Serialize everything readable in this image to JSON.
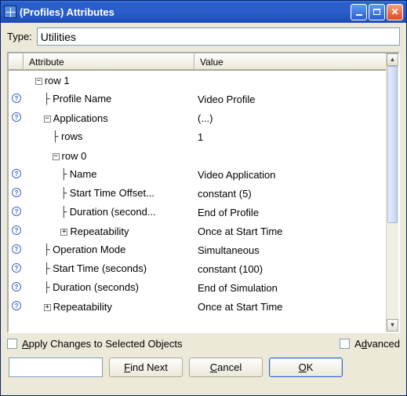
{
  "window": {
    "title": "(Profiles) Attributes"
  },
  "type": {
    "label": "Type:",
    "value": "Utilities"
  },
  "grid": {
    "headers": {
      "attribute": "Attribute",
      "value": "Value"
    },
    "rows": [
      {
        "indent": 1,
        "box": "-",
        "help": "",
        "attr": "row 1",
        "val": ""
      },
      {
        "indent": 2,
        "box": "",
        "help": "?",
        "attr": "Profile Name",
        "val": "Video Profile"
      },
      {
        "indent": 2,
        "box": "-",
        "help": "?",
        "attr": "Applications",
        "val": "(...)"
      },
      {
        "indent": 3,
        "box": "",
        "help": "",
        "attr": "rows",
        "val": "1"
      },
      {
        "indent": 3,
        "box": "-",
        "help": "",
        "attr": "row 0",
        "val": ""
      },
      {
        "indent": 4,
        "box": "",
        "help": "?",
        "attr": "Name",
        "val": "Video Application"
      },
      {
        "indent": 4,
        "box": "",
        "help": "?",
        "attr": "Start Time Offset...",
        "val": "constant (5)"
      },
      {
        "indent": 4,
        "box": "",
        "help": "?",
        "attr": "Duration (second...",
        "val": "End of Profile"
      },
      {
        "indent": 4,
        "box": "+",
        "help": "?",
        "attr": "Repeatability",
        "val": "Once at Start Time"
      },
      {
        "indent": 2,
        "box": "",
        "help": "?",
        "attr": "Operation Mode",
        "val": "Simultaneous"
      },
      {
        "indent": 2,
        "box": "",
        "help": "?",
        "attr": "Start Time (seconds)",
        "val": "constant (100)"
      },
      {
        "indent": 2,
        "box": "",
        "help": "?",
        "attr": "Duration (seconds)",
        "val": "End of Simulation"
      },
      {
        "indent": 2,
        "box": "+",
        "help": "?",
        "attr": "Repeatability",
        "val": "Once at Start Time"
      }
    ]
  },
  "checkboxes": {
    "apply": "Apply Changes to Selected Objects",
    "advanced": "Advanced"
  },
  "buttons": {
    "find_next": "Find Next",
    "cancel": "Cancel",
    "ok": "OK"
  }
}
